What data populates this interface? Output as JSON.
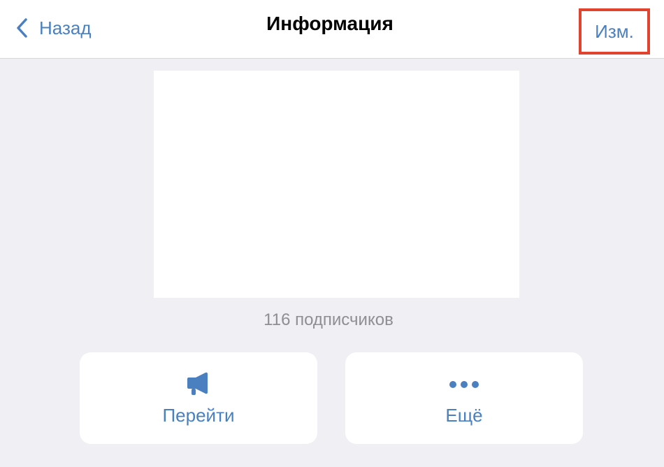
{
  "header": {
    "back_label": "Назад",
    "title": "Информация",
    "edit_label": "Изм."
  },
  "channel": {
    "subscribers": "116 подписчиков"
  },
  "actions": {
    "go_label": "Перейти",
    "more_label": "Ещё"
  },
  "colors": {
    "accent": "#4a80c0",
    "background": "#efeff4",
    "highlight": "#e0442e"
  }
}
